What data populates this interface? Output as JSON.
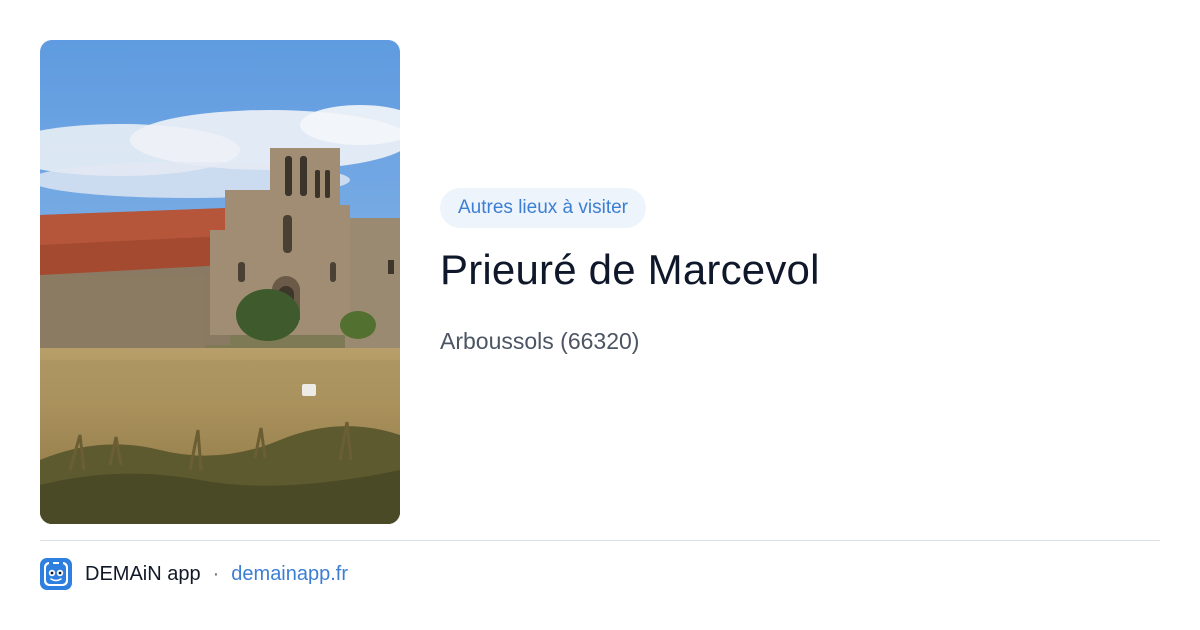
{
  "photo": {
    "alt": "Prieuré de Marcevol"
  },
  "card": {
    "category_chip": "Autres lieux à visiter",
    "title": "Prieuré de Marcevol",
    "location": "Arboussols (66320)"
  },
  "footer": {
    "app_icon": "demain-app-icon",
    "app_name": "DEMAiN app",
    "separator": "·",
    "site": "demainapp.fr"
  },
  "colors": {
    "accent": "#3b7ed3",
    "chip_background": "#eef4fc",
    "divider": "#dbe3ea",
    "title": "#0f172a",
    "subtitle": "#4b5563"
  }
}
